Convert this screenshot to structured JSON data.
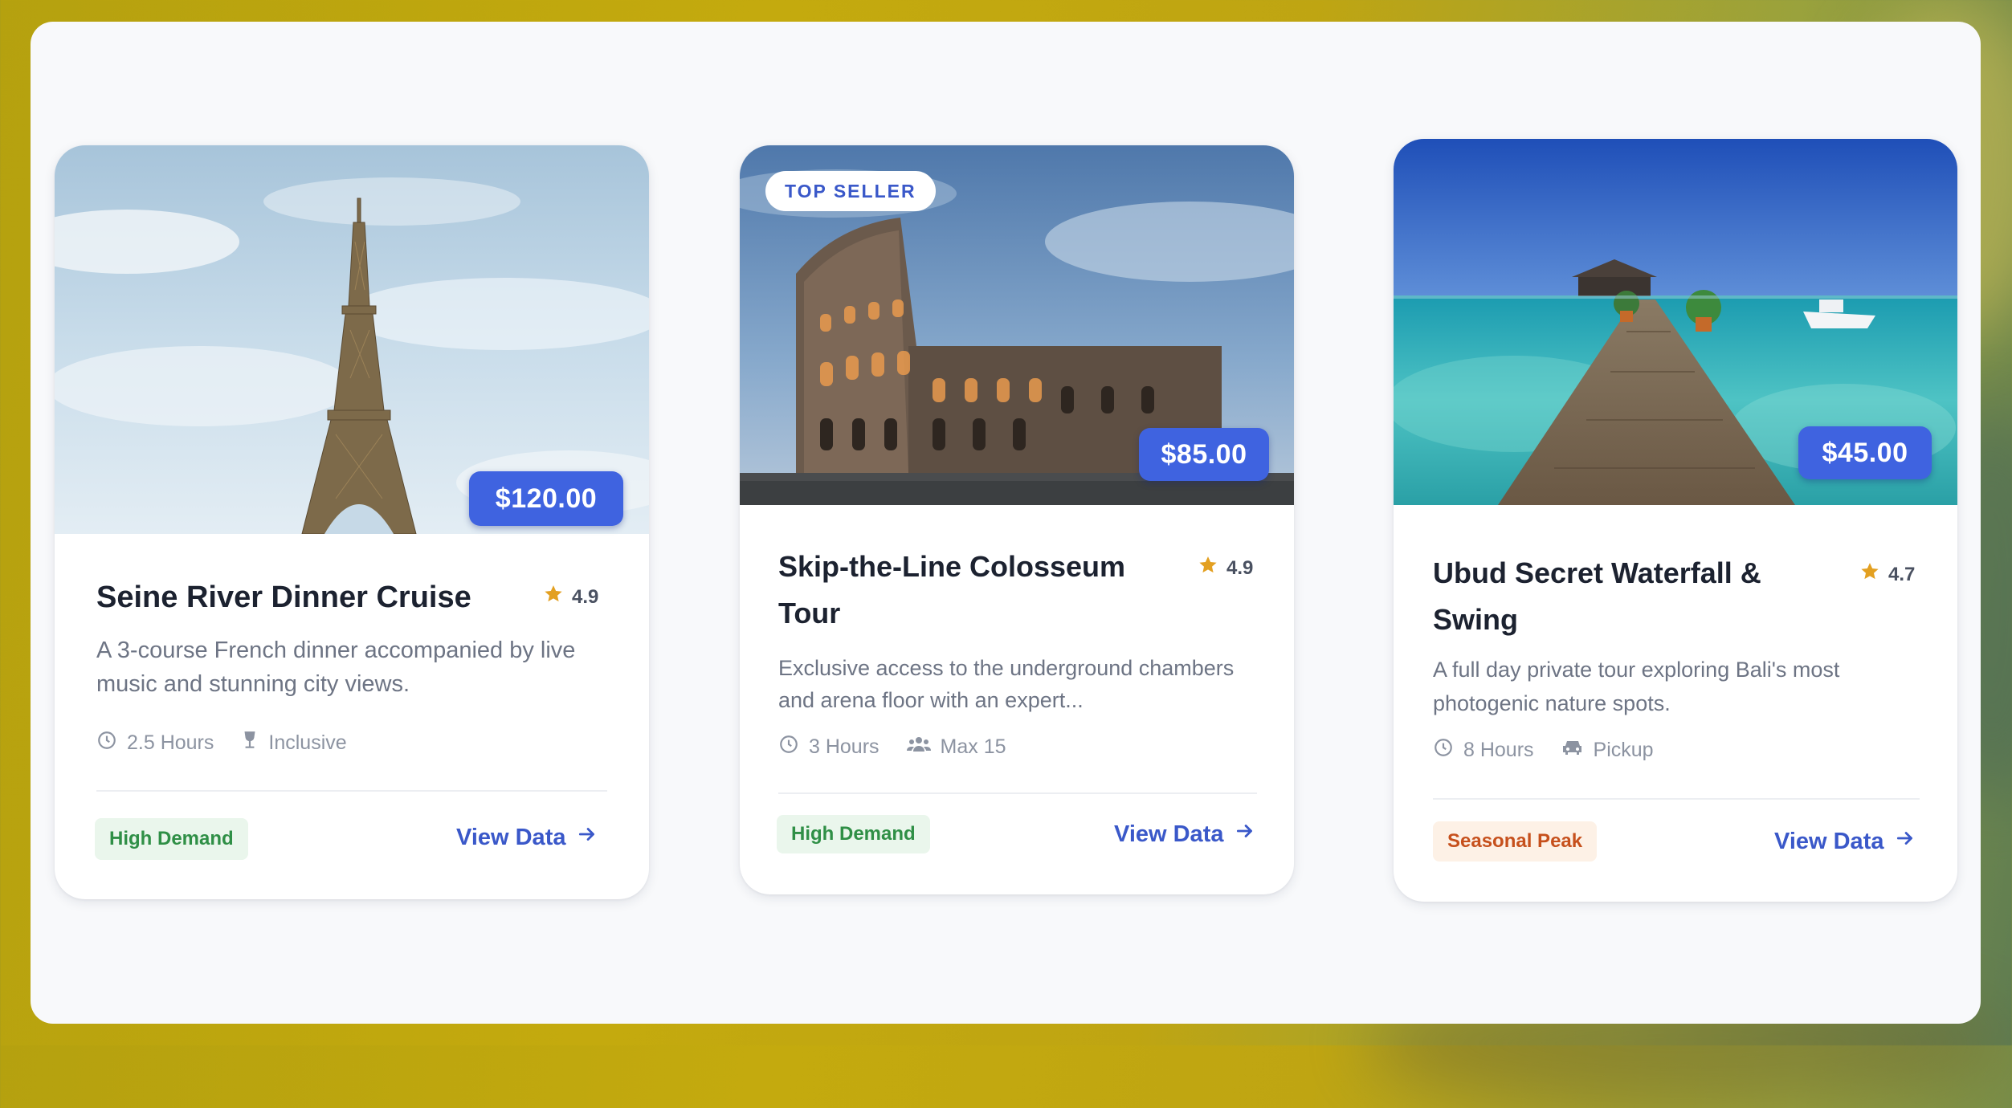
{
  "colors": {
    "accent": "#3f63e0",
    "link": "#3a58c9",
    "star": "#e3a021",
    "demand_green": "#2f8f46",
    "seasonal_orange": "#c6501c"
  },
  "cards": [
    {
      "badge": "",
      "price": "$120.00",
      "title": "Seine River Dinner Cruise",
      "rating": "4.9",
      "description": "A 3-course French dinner accompanied by live music and stunning city views.",
      "meta": [
        {
          "icon": "clock-icon",
          "text": "2.5 Hours"
        },
        {
          "icon": "wine-glass-icon",
          "text": "Inclusive"
        }
      ],
      "tag": "High Demand",
      "cta": "View Data"
    },
    {
      "badge": "TOP SELLER",
      "price": "$85.00",
      "title": "Skip-the-Line Colosseum Tour",
      "rating": "4.9",
      "description": "Exclusive access to the underground chambers and arena floor with an expert...",
      "meta": [
        {
          "icon": "clock-icon",
          "text": "3 Hours"
        },
        {
          "icon": "group-icon",
          "text": "Max 15"
        }
      ],
      "tag": "High Demand",
      "cta": "View Data"
    },
    {
      "badge": "",
      "price": "$45.00",
      "title": "Ubud Secret Waterfall & Swing",
      "rating": "4.7",
      "description": "A full day private tour exploring Bali's most photogenic nature spots.",
      "meta": [
        {
          "icon": "clock-icon",
          "text": "8 Hours"
        },
        {
          "icon": "car-icon",
          "text": "Pickup"
        }
      ],
      "tag": "Seasonal Peak",
      "cta": "View Data"
    }
  ]
}
